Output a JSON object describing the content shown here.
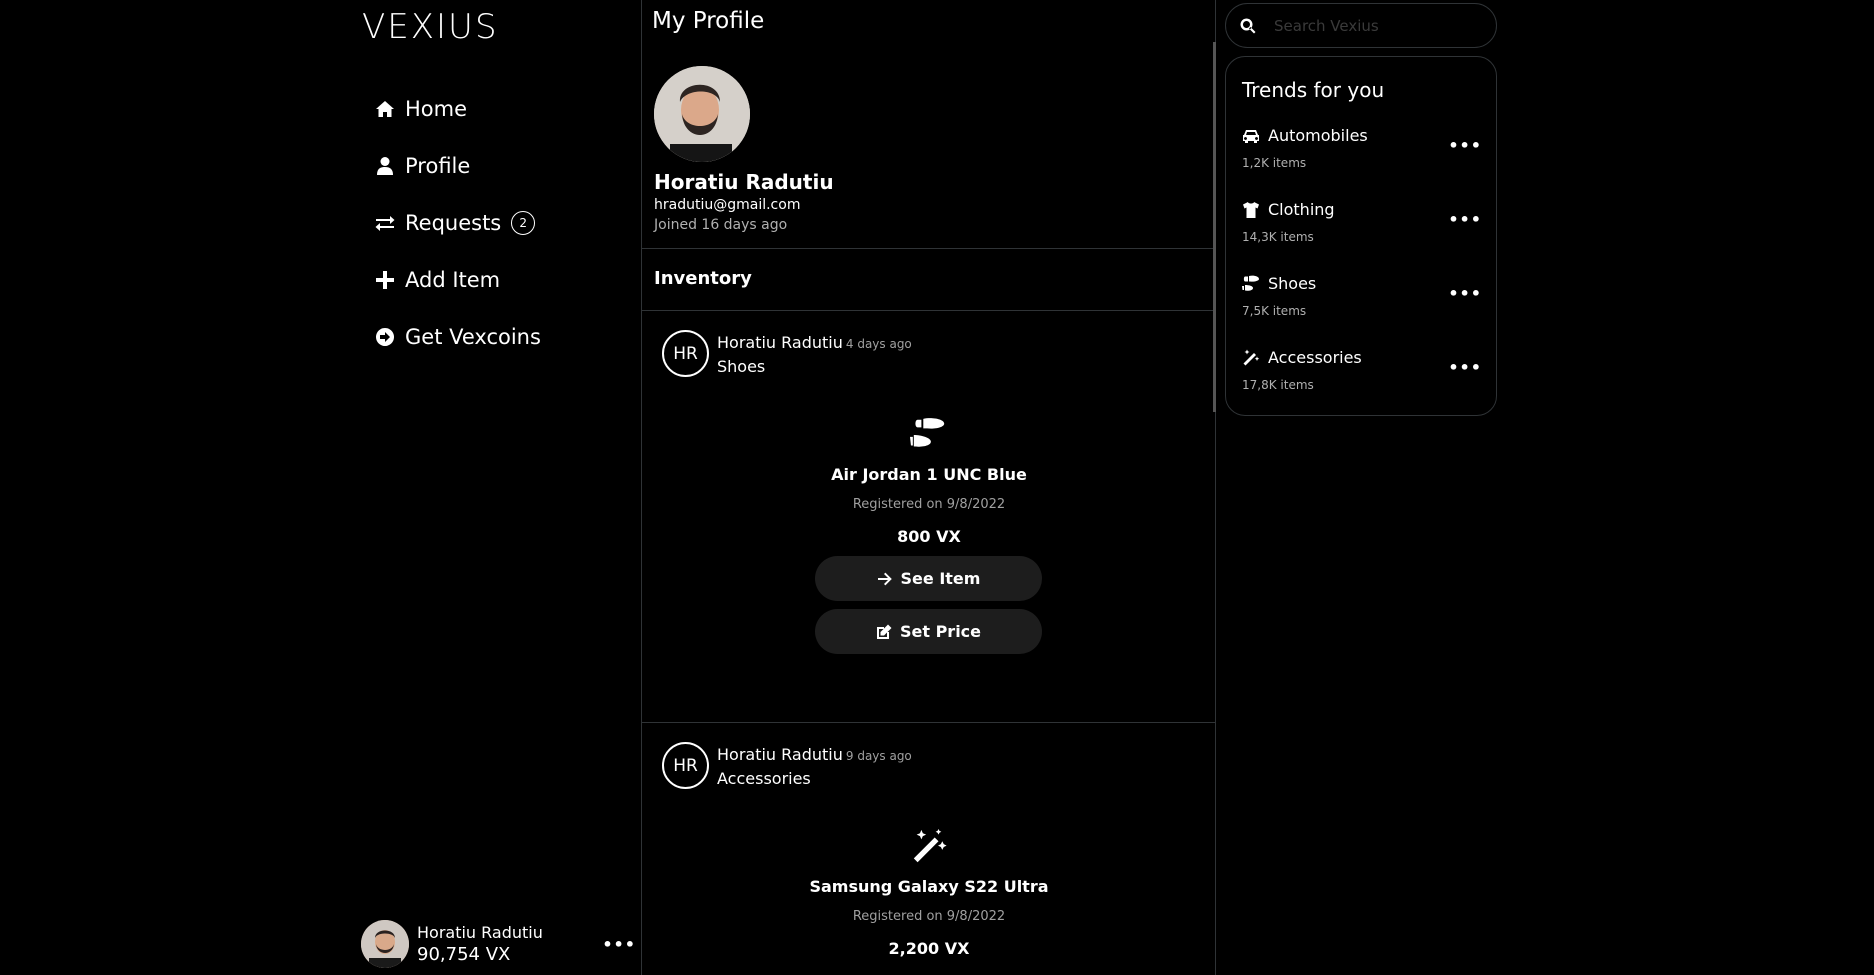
{
  "app": {
    "logo": "VEXIUS"
  },
  "sidebar": {
    "items": [
      {
        "label": "Home",
        "icon": "home-icon"
      },
      {
        "label": "Profile",
        "icon": "user-icon"
      },
      {
        "label": "Requests",
        "icon": "exchange-icon",
        "badge": "2"
      },
      {
        "label": "Add Item",
        "icon": "plus-icon"
      },
      {
        "label": "Get Vexcoins",
        "icon": "arrow-circle-right-icon"
      }
    ],
    "user": {
      "name": "Horatiu Radutiu",
      "balance": "90,754 VX",
      "more": "•••"
    }
  },
  "main": {
    "title": "My Profile",
    "profile": {
      "name": "Horatiu Radutiu",
      "email": "hradutiu@gmail.com",
      "joined": "Joined 16 days ago"
    },
    "inventory_title": "Inventory",
    "posts": [
      {
        "initials": "HR",
        "user": "Horatiu Radutiu",
        "time": "4 days ago",
        "category": "Shoes",
        "item_icon": "shoe-prints-icon",
        "item_name": "Air Jordan 1 UNC Blue",
        "registered": "Registered on 9/8/2022",
        "price": "800 VX",
        "see_item_label": "See Item",
        "set_price_label": "Set Price"
      },
      {
        "initials": "HR",
        "user": "Horatiu Radutiu",
        "time": "9 days ago",
        "category": "Accessories",
        "item_icon": "magic-wand-icon",
        "item_name": "Samsung Galaxy S22 Ultra",
        "registered": "Registered on 9/8/2022",
        "price": "2,200 VX"
      }
    ]
  },
  "right": {
    "search": {
      "placeholder": "Search Vexius"
    },
    "trends": {
      "title": "Trends for you",
      "items": [
        {
          "label": "Automobiles",
          "icon": "car-icon",
          "count": "1,2K items",
          "more": "•••"
        },
        {
          "label": "Clothing",
          "icon": "tshirt-icon",
          "count": "14,3K items",
          "more": "•••"
        },
        {
          "label": "Shoes",
          "icon": "shoe-prints-icon",
          "count": "7,5K items",
          "more": "•••"
        },
        {
          "label": "Accessories",
          "icon": "magic-wand-icon",
          "count": "17,8K items",
          "more": "•••"
        }
      ]
    }
  },
  "colors": {
    "background": "#000000",
    "border": "#2f3336",
    "button": "#1d1d1d",
    "muted": "#a0a0a0"
  }
}
